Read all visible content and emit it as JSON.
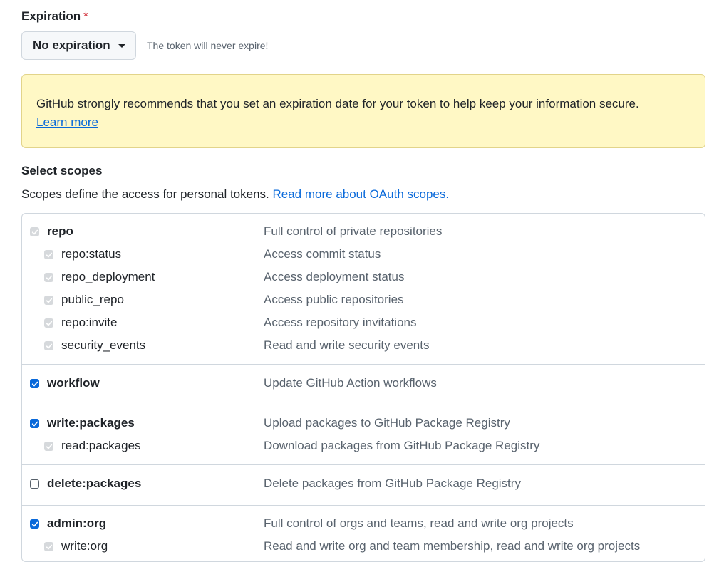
{
  "expiration": {
    "label": "Expiration",
    "required_mark": "*",
    "selected": "No expiration",
    "note": "The token will never expire!"
  },
  "warning": {
    "text": "GitHub strongly recommends that you set an expiration date for your token to help keep your information secure.",
    "link": "Learn more",
    "color": "#fff8c5"
  },
  "scopes": {
    "title": "Select scopes",
    "description": "Scopes define the access for personal tokens.",
    "link": "Read more about OAuth scopes.",
    "groups": [
      {
        "items": [
          {
            "name": "repo",
            "desc": "Full control of private repositories",
            "level": "parent",
            "state": "disabled"
          },
          {
            "name": "repo:status",
            "desc": "Access commit status",
            "level": "child",
            "state": "disabled"
          },
          {
            "name": "repo_deployment",
            "desc": "Access deployment status",
            "level": "child",
            "state": "disabled"
          },
          {
            "name": "public_repo",
            "desc": "Access public repositories",
            "level": "child",
            "state": "disabled"
          },
          {
            "name": "repo:invite",
            "desc": "Access repository invitations",
            "level": "child",
            "state": "disabled"
          },
          {
            "name": "security_events",
            "desc": "Read and write security events",
            "level": "child",
            "state": "disabled"
          }
        ]
      },
      {
        "items": [
          {
            "name": "workflow",
            "desc": "Update GitHub Action workflows",
            "level": "parent",
            "state": "checked"
          }
        ]
      },
      {
        "items": [
          {
            "name": "write:packages",
            "desc": "Upload packages to GitHub Package Registry",
            "level": "parent",
            "state": "checked"
          },
          {
            "name": "read:packages",
            "desc": "Download packages from GitHub Package Registry",
            "level": "child",
            "state": "disabled"
          }
        ]
      },
      {
        "items": [
          {
            "name": "delete:packages",
            "desc": "Delete packages from GitHub Package Registry",
            "level": "parent",
            "state": "unchecked"
          }
        ]
      },
      {
        "items": [
          {
            "name": "admin:org",
            "desc": "Full control of orgs and teams, read and write org projects",
            "level": "parent",
            "state": "checked"
          },
          {
            "name": "write:org",
            "desc": "Read and write org and team membership, read and write org projects",
            "level": "child",
            "state": "disabled"
          }
        ]
      }
    ]
  },
  "colors": {
    "accent": "#0969da",
    "required": "#cf222e"
  }
}
